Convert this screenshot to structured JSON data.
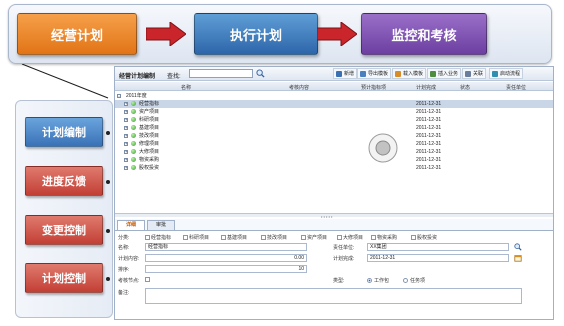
{
  "flow": {
    "stages": [
      "经营计划",
      "执行计划",
      "监控和考核"
    ]
  },
  "functions": [
    "计划编制",
    "进度反馈",
    "变更控制",
    "计划控制"
  ],
  "toolbar": {
    "title": "经营计划编制",
    "search_label": "查找:",
    "buttons": [
      "新增",
      "导出模板",
      "载入模板",
      "插入业务",
      "关联",
      "启动流程"
    ]
  },
  "grid": {
    "columns": [
      "名称",
      "考核内容",
      "预计指标项",
      "计划完成",
      "状态",
      "责任单位"
    ],
    "root": "2011年度",
    "rows": [
      {
        "label": "经营指标",
        "date": "2011-12-31",
        "selected": true
      },
      {
        "label": "资产项目",
        "date": "2011-12-31",
        "selected": false
      },
      {
        "label": "科研项目",
        "date": "2011-12-31",
        "selected": false
      },
      {
        "label": "基建项目",
        "date": "2011-12-31",
        "selected": false
      },
      {
        "label": "技改项目",
        "date": "2011-12-31",
        "selected": false
      },
      {
        "label": "修理项目",
        "date": "2011-12-31",
        "selected": false
      },
      {
        "label": "大修项目",
        "date": "2011-12-31",
        "selected": false
      },
      {
        "label": "物资采购",
        "date": "2011-12-31",
        "selected": false
      },
      {
        "label": "股权投资",
        "date": "2011-12-31",
        "selected": false
      }
    ]
  },
  "splitter_label": "• • • • •",
  "detail": {
    "tabs": [
      "详细",
      "审批"
    ],
    "category_label": "分类:",
    "categories": [
      "经营指标",
      "科研项目",
      "基建项目",
      "技改项目",
      "资产项目",
      "大修项目",
      "物资采购",
      "股权投资"
    ],
    "name_label": "名称:",
    "name_value": "经营指标",
    "planned_label": "计划内容:",
    "planned_value": "0.00",
    "order_label": "排序:",
    "order_value": "10",
    "assess_label": "考核节点:",
    "unit_label": "责任单位:",
    "unit_value": "XX集团",
    "complete_label": "计划完成:",
    "complete_value": "2011-12-31",
    "type_label": "类型:",
    "type_options": [
      "工作包",
      "任务项"
    ],
    "remark_label": "备注:"
  },
  "colors": {
    "orange": "#e27416",
    "blue": "#2e66aa",
    "purple": "#6c3fa1",
    "red": "#c23f35",
    "arrow": "#c9252b"
  }
}
